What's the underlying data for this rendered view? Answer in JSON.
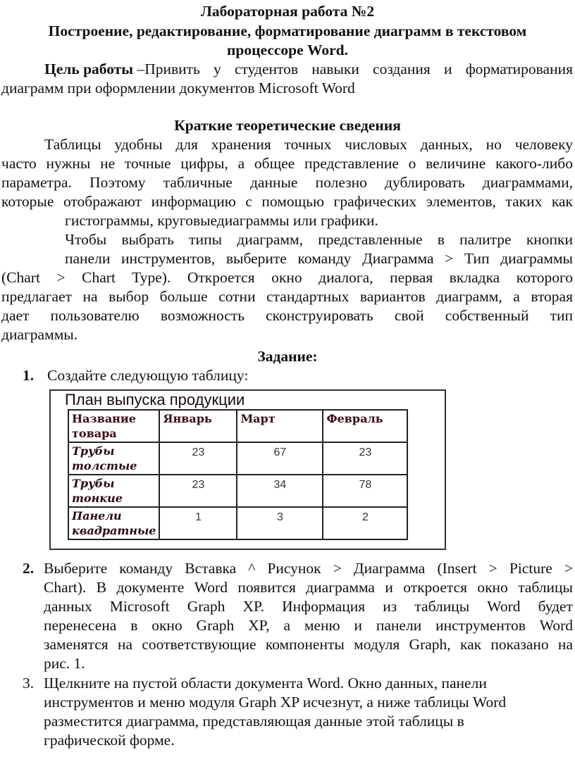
{
  "header": {
    "title": "Лабораторная работа №2",
    "subtitle_line1": "Построение, редактирование, форматирование диаграмм в текстовом",
    "subtitle_line2": "процессоре Word."
  },
  "goal": {
    "label": "Цель работы",
    "dash": " – ",
    "text_line1": "Привить у студентов навыки создания и форматирования",
    "text_line2": "диаграмм при оформлении документов Microsoft Word"
  },
  "theory": {
    "heading": "Краткие теоретические сведения",
    "p1_lines": [
      "Таблицы удобны для хранения точных числовых данных, но человеку",
      "часто нужны не точные цифры, а общее представление о величине какого-либо",
      "параметра. Поэтому табличные данные полезно дублировать диаграммами,",
      "которые отображают информацию с помощью графических элементов, таких как",
      "гистограммы, круговыедиаграммы или графики."
    ],
    "p2_lines": [
      "Чтобы выбрать типы диаграмм, представленные в палитре кнопки",
      "панели инструментов, выберите команду Диаграмма > Тип диаграммы",
      "(Chart > Chart Type). Откроется окно диалога, первая вкладка которого",
      "предлагает на выбор больше сотни стандартных вариантов диаграмм, а вторая",
      "дает пользователю возможность сконструировать свой собственный тип",
      "диаграммы."
    ]
  },
  "task": {
    "heading": "Задание:",
    "step1": {
      "number": "1.",
      "text": "Создайте следующую таблицу:"
    },
    "step2": {
      "number": "2.",
      "lines": [
        "Выберите команду Вставка ^ Рисунок > Диаграмма (Insert > Picture >",
        "Chart). В документе Word появится диаграмма и откроется окно таблицы",
        "данных Microsoft Graph XP. Информация из таблицы Word будет",
        "перенесена в окно Graph XP, а меню и панели инструментов Word",
        "заменятся на соответствующие компоненты модуля Graph, как показано на",
        "рис. 1."
      ]
    },
    "step3": {
      "number": "3.",
      "lines": [
        "Щелкните на пустой области документа Word. Окно данных, панели",
        "инструментов и меню модуля Graph XP исчезнут, а ниже таблицы Word",
        "разместится диаграмма, представляющая данные этой таблицы в",
        "графической форме."
      ]
    }
  },
  "table": {
    "title": "План выпуска продукции",
    "headers": [
      "Название товара",
      "Январь",
      "Март",
      "Февраль"
    ],
    "header_first_lines": [
      "Название",
      "товара"
    ],
    "rows": [
      {
        "name_lines": [
          "Трубы",
          "толстые"
        ],
        "values": [
          "23",
          "67",
          "23"
        ]
      },
      {
        "name_lines": [
          "Трубы",
          "тонкие"
        ],
        "values": [
          "23",
          "34",
          "78"
        ]
      },
      {
        "name_lines": [
          "Панели",
          "квадратные"
        ],
        "values": [
          "1",
          "3",
          "2"
        ]
      }
    ]
  }
}
